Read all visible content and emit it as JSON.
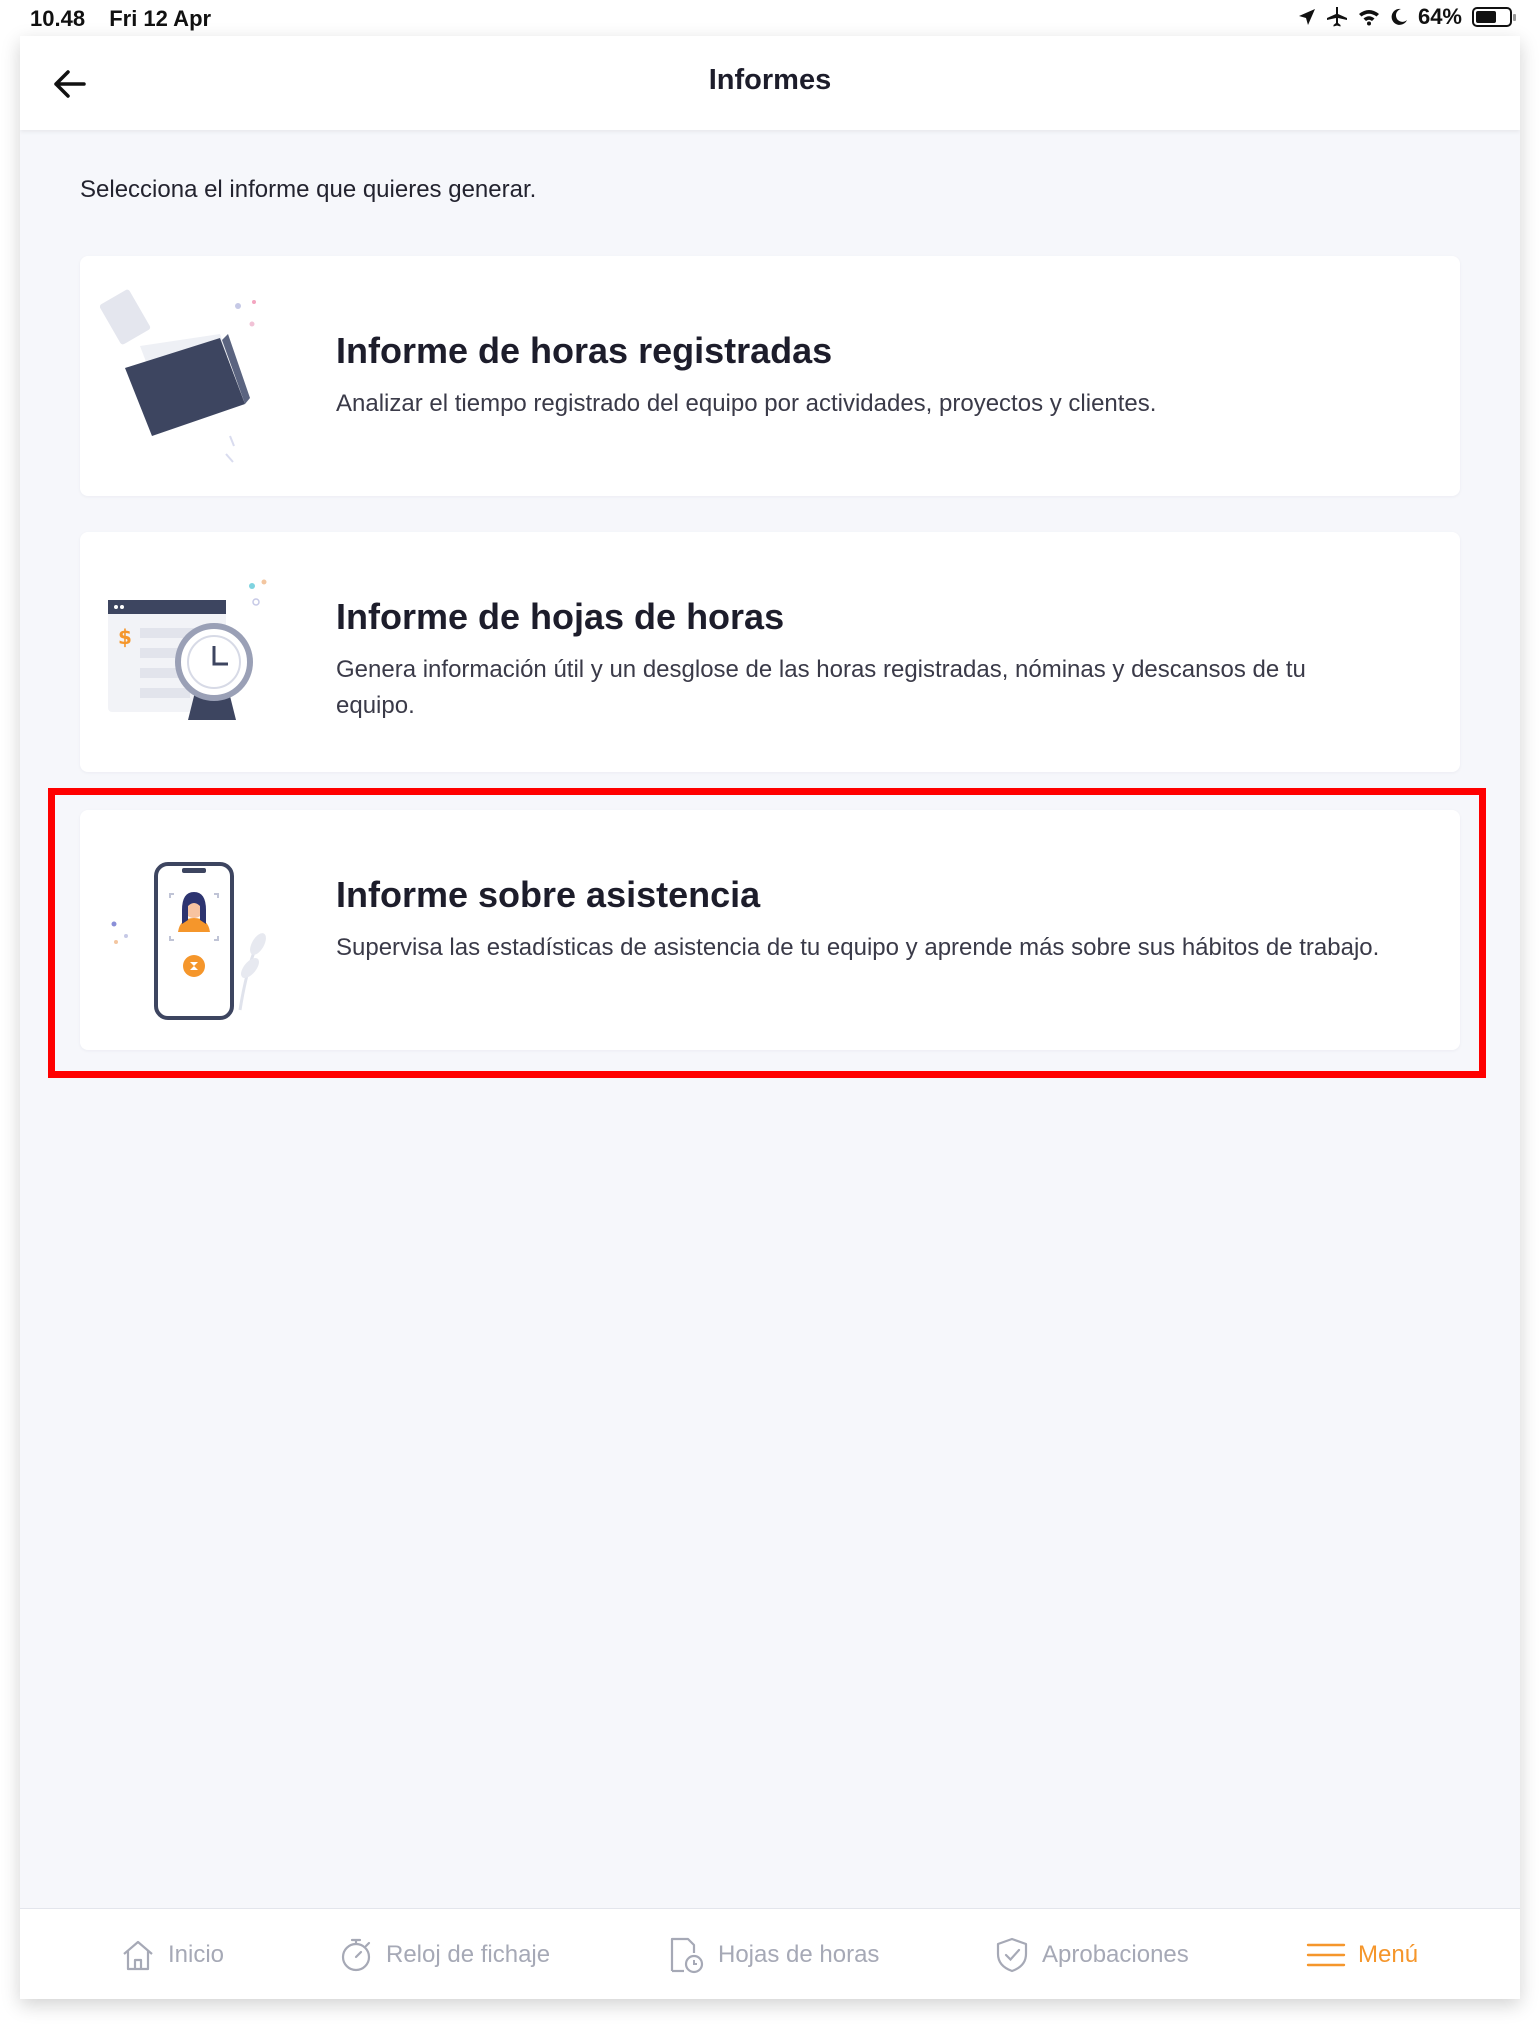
{
  "status_bar": {
    "time": "10.48",
    "date": "Fri 12 Apr",
    "battery": "64%",
    "battery_level": 0.64
  },
  "header": {
    "title": "Informes",
    "back_icon": "arrow-left-icon"
  },
  "main": {
    "intro": "Selecciona el informe que quieres generar.",
    "cards": [
      {
        "title": "Informe de horas registradas",
        "description": "Analizar el tiempo registrado del equipo por actividades, proyectos y clientes.",
        "icon": "folder-illustration"
      },
      {
        "title": "Informe de hojas de horas",
        "description": "Genera información útil y un desglose de las horas registradas, nóminas y descansos de tu equipo.",
        "icon": "timesheet-clock-illustration"
      },
      {
        "title": "Informe sobre asistencia",
        "description": "Supervisa las estadísticas de asistencia de tu equipo y aprende más sobre sus hábitos de trabajo.",
        "icon": "phone-attendance-illustration",
        "highlighted": true
      }
    ]
  },
  "tab_bar": {
    "items": [
      {
        "label": "Inicio",
        "icon": "home-icon"
      },
      {
        "label": "Reloj de fichaje",
        "icon": "stopwatch-icon"
      },
      {
        "label": "Hojas de horas",
        "icon": "timesheet-icon"
      },
      {
        "label": "Aprobaciones",
        "icon": "shield-check-icon"
      },
      {
        "label": "Menú",
        "icon": "menu-icon",
        "active": true
      }
    ]
  },
  "colors": {
    "accent": "#f5962b",
    "highlight": "#ff0000",
    "background": "#f6f7fb",
    "inactive": "#a6a9b6"
  }
}
